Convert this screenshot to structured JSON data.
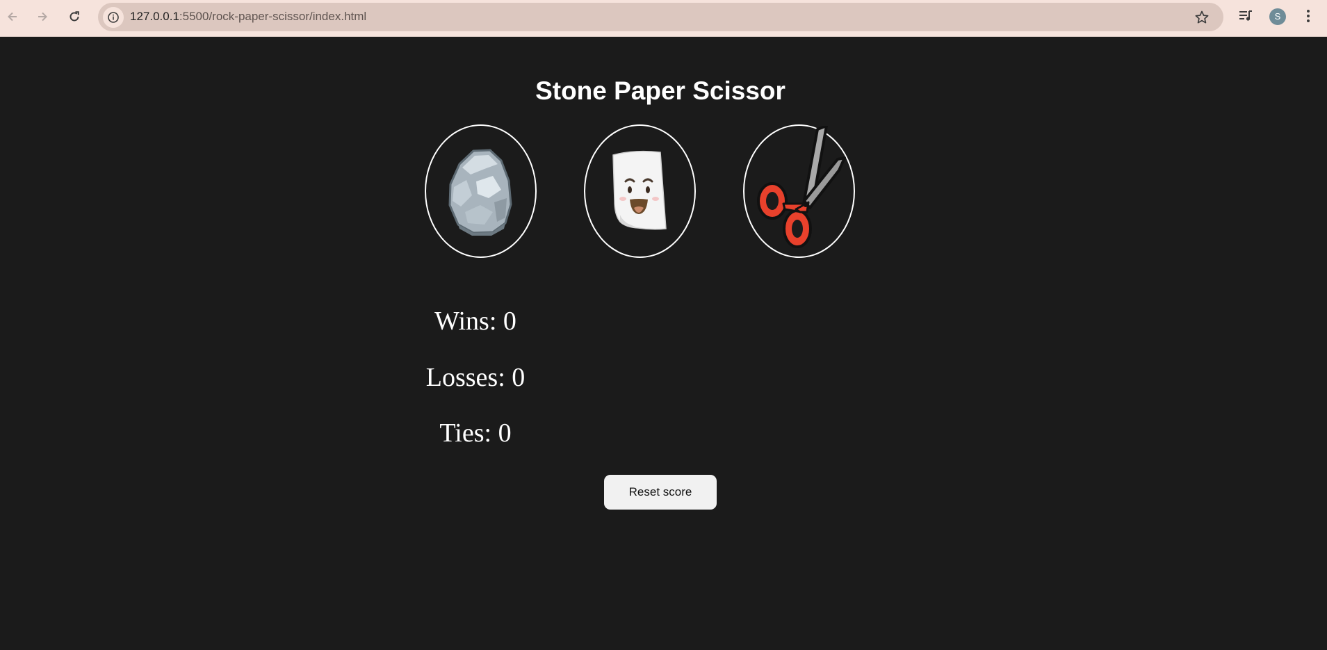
{
  "browser": {
    "url_host": "127.0.0.1",
    "url_path": ":5500/rock-paper-scissor/index.html",
    "avatar_letter": "S",
    "icons": [
      "back-icon",
      "forward-icon",
      "reload-icon",
      "site-info-icon",
      "bookmark-star-icon",
      "media-control-icon",
      "more-menu-icon"
    ]
  },
  "page": {
    "title": "Stone Paper Scissor",
    "choices": [
      {
        "name": "stone",
        "icon": "stone-icon"
      },
      {
        "name": "paper",
        "icon": "paper-icon"
      },
      {
        "name": "scissor",
        "icon": "scissor-icon"
      }
    ],
    "scores": {
      "wins_label": "Wins: 0",
      "losses_label": "Losses: 0",
      "ties_label": "Ties: 0"
    },
    "reset_label": "Reset score"
  },
  "colors": {
    "background": "#1b1b1b",
    "chrome": "#f6e3dc",
    "omnibox": "#dcc7bf",
    "button": "#f1f1f1",
    "text": "#ffffff"
  }
}
